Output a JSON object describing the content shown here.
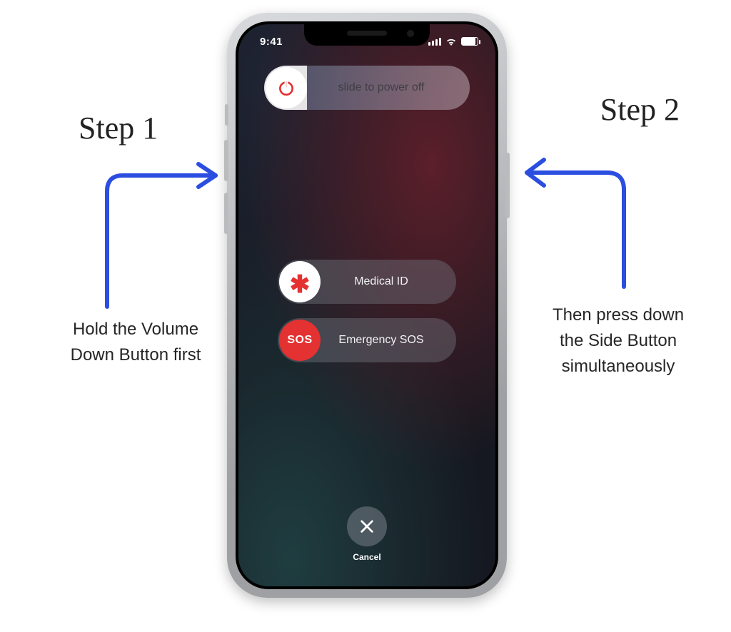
{
  "status": {
    "time": "9:41"
  },
  "sliders": {
    "power": "slide to power off",
    "medical": "Medical ID",
    "sos_icon_text": "SOS",
    "sos": "Emergency SOS"
  },
  "cancel": {
    "label": "Cancel"
  },
  "steps": {
    "left": {
      "title": "Step 1",
      "body": "Hold the Volume Down Button first"
    },
    "right": {
      "title": "Step 2",
      "body": "Then press down the Side Button simultaneously"
    }
  },
  "colors": {
    "arrow": "#2b4ee0",
    "sos_red": "#e43131"
  }
}
